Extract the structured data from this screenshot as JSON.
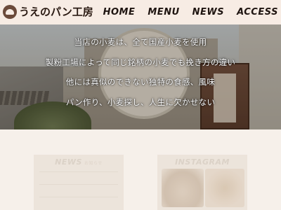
{
  "header": {
    "logo_text": "うえのパン工房",
    "nav": [
      "HOME",
      "MENU",
      "NEWS",
      "ACCESS"
    ]
  },
  "hero": {
    "lines": [
      "当店の小麦は、全て国産小麦を使用",
      "製粉工場によって同じ銘柄の小麦でも挽き方の違い",
      "他には真似のできない独特の食感、風味",
      "パン作り、小麦探し、人生に欠かせない"
    ]
  },
  "sections": {
    "news_title": "NEWS",
    "news_sub": "お知らせ",
    "instagram_title": "INSTAGRAM"
  },
  "colors": {
    "header_bg": "#f7ece4",
    "nav_text": "#1e1410",
    "hero_text": "#ffffff",
    "page_bg": "#f6f0ea"
  }
}
